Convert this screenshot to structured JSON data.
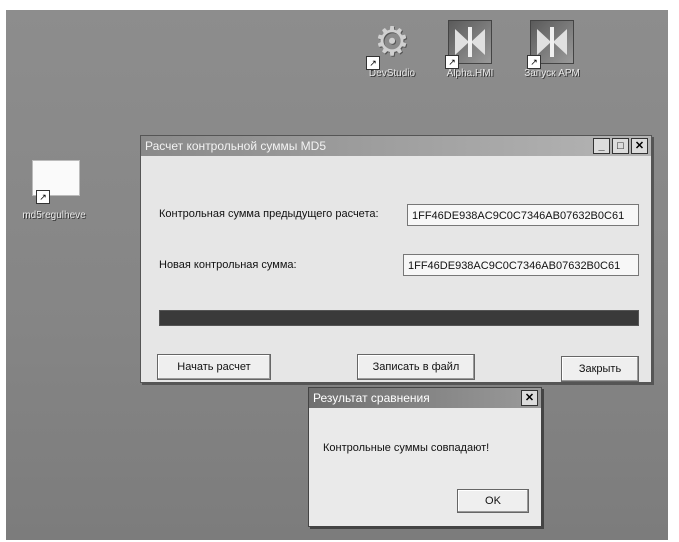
{
  "desktop": {
    "icons": [
      {
        "name": "devstudio",
        "label": "DevStudio"
      },
      {
        "name": "alphahmi",
        "label": "Alpha.HMI"
      },
      {
        "name": "apm",
        "label": "Запуск АРМ"
      },
      {
        "name": "md5",
        "label": "md5regulheve"
      }
    ]
  },
  "main_window": {
    "title": "Расчет контрольной суммы MD5",
    "controls": {
      "minimize": "_",
      "maximize": "□",
      "close": "✕"
    },
    "prev_label": "Контрольная сумма предыдущего расчета:",
    "prev_value": "1FF46DE938AC9C0C7346AB07632B0C61",
    "new_label": "Новая контрольная сумма:",
    "new_value": "1FF46DE938AC9C0C7346AB07632B0C61",
    "progress_fraction": 1.0,
    "buttons": {
      "start": "Начать расчет",
      "write": "Записать в файл",
      "close": "Закрыть"
    }
  },
  "dialog": {
    "title": "Результат сравнения",
    "close_glyph": "✕",
    "message": "Контрольные суммы совпадают!",
    "ok": "OK"
  }
}
